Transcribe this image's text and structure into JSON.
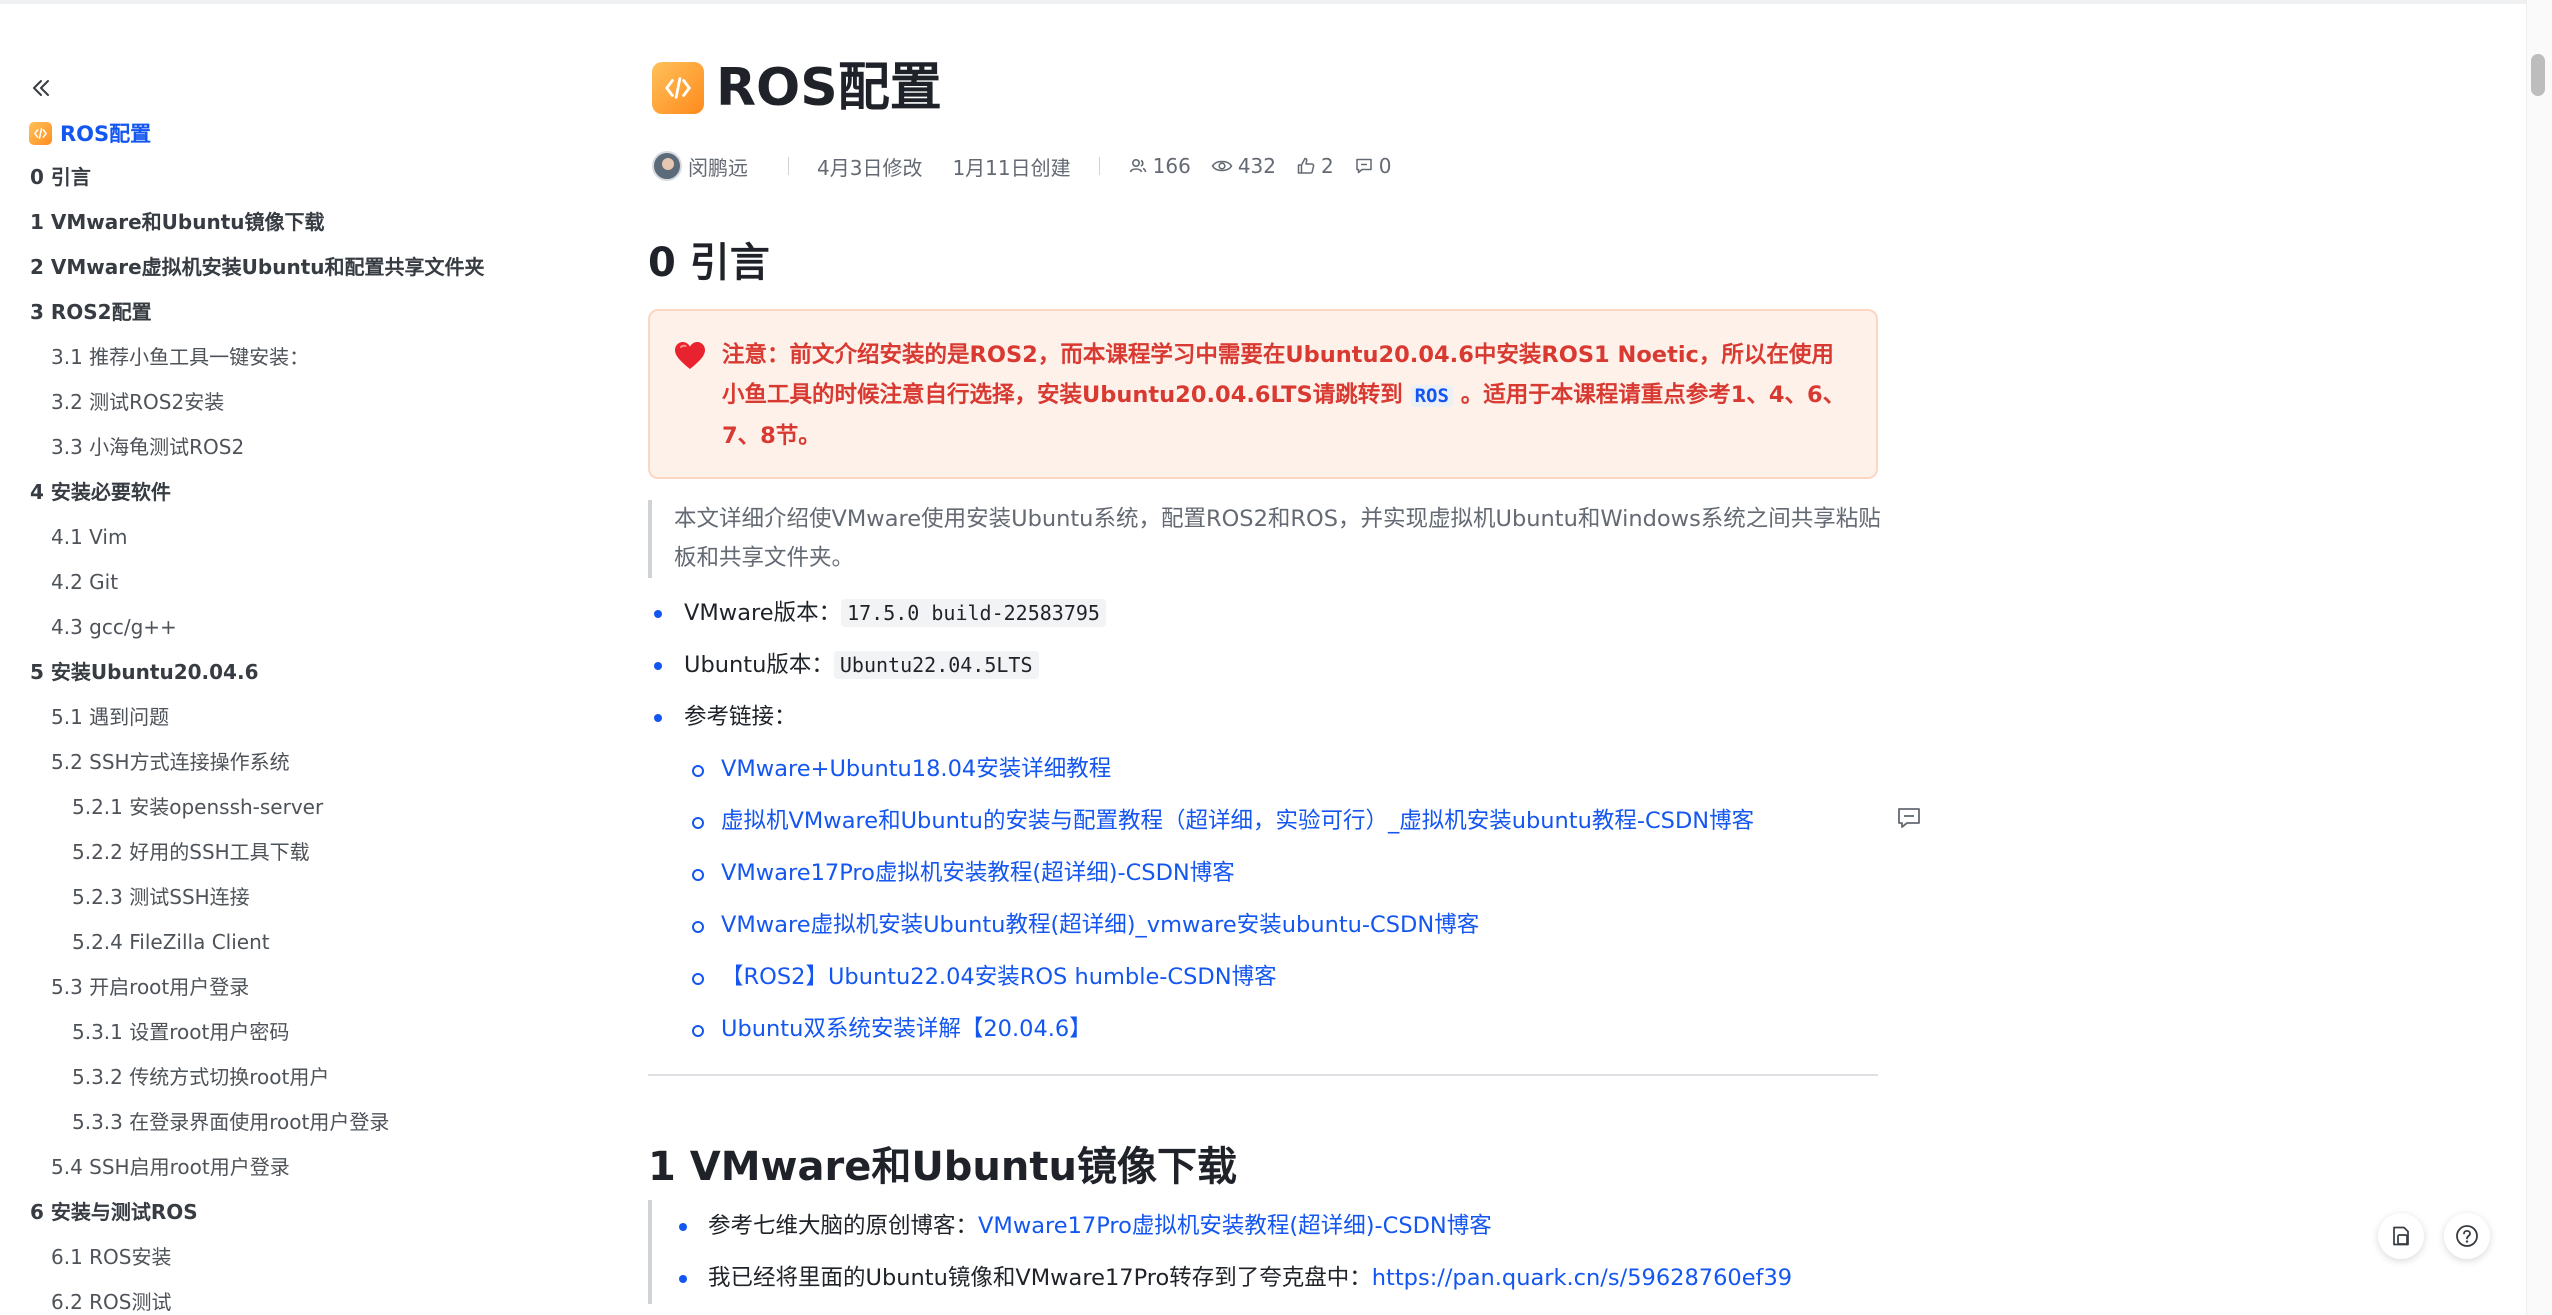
{
  "sidebar": {
    "current": "ROS配置",
    "toc": [
      {
        "label": "0 引言",
        "level": 1
      },
      {
        "label": "1 VMware和Ubuntu镜像下载",
        "level": 1
      },
      {
        "label": "2 VMware虚拟机安装Ubuntu和配置共享文件夹",
        "level": 1
      },
      {
        "label": "3 ROS2配置",
        "level": 1
      },
      {
        "label": "3.1 推荐小鱼工具一键安装：",
        "level": 2
      },
      {
        "label": "3.2 测试ROS2安装",
        "level": 2
      },
      {
        "label": "3.3 小海龟测试ROS2",
        "level": 2
      },
      {
        "label": "4 安装必要软件",
        "level": 1
      },
      {
        "label": "4.1 Vim",
        "level": 2
      },
      {
        "label": "4.2 Git",
        "level": 2
      },
      {
        "label": "4.3 gcc/g++",
        "level": 2
      },
      {
        "label": "5 安装Ubuntu20.04.6",
        "level": 1
      },
      {
        "label": "5.1 遇到问题",
        "level": 2
      },
      {
        "label": "5.2 SSH方式连接操作系统",
        "level": 2
      },
      {
        "label": "5.2.1 安装openssh-server",
        "level": 3
      },
      {
        "label": "5.2.2 好用的SSH工具下载",
        "level": 3
      },
      {
        "label": "5.2.3 测试SSH连接",
        "level": 3
      },
      {
        "label": "5.2.4 FileZilla Client",
        "level": 3
      },
      {
        "label": "5.3 开启root用户登录",
        "level": 2
      },
      {
        "label": "5.3.1 设置root用户密码",
        "level": 3
      },
      {
        "label": "5.3.2 传统方式切换root用户",
        "level": 3
      },
      {
        "label": "5.3.3 在登录界面使用root用户登录",
        "level": 3
      },
      {
        "label": "5.4 SSH启用root用户登录",
        "level": 2
      },
      {
        "label": "6 安装与测试ROS",
        "level": 1
      },
      {
        "label": "6.1 ROS安装",
        "level": 2
      },
      {
        "label": "6.2 ROS测试",
        "level": 2
      }
    ]
  },
  "doc": {
    "title": "ROS配置",
    "author": "闵鹏远",
    "modified": "4月3日修改",
    "created": "1月11日创建",
    "stats": {
      "collaborators": "166",
      "views": "432",
      "likes": "2",
      "comments": "0"
    }
  },
  "section0": {
    "heading": "0 引言",
    "callout": {
      "text_before": "注意：前文介绍安装的是ROS2，而本课程学习中需要在Ubuntu20.04.6中安装ROS1 Noetic，所以在使用小鱼工具的时候注意自行选择，安装Ubuntu20.04.6LTS请跳转到 ",
      "code": "ROS",
      "text_after": " 。适用于本课程请重点参考1、4、6、7、8节。"
    },
    "quote": "本文详细介绍使VMware使用安装Ubuntu系统，配置ROS2和ROS，并实现虚拟机Ubuntu和Windows系统之间共享粘贴板和共享文件夹。",
    "vmware_label": "VMware版本：",
    "vmware_code": "17.5.0 build-22583795",
    "ubuntu_label": "Ubuntu版本：",
    "ubuntu_code": "Ubuntu22.04.5LTS",
    "refs_label": "参考链接：",
    "links": [
      "VMware+Ubuntu18.04安装详细教程",
      "虚拟机VMware和Ubuntu的安装与配置教程（超详细，实验可行）_虚拟机安装ubuntu教程-CSDN博客",
      "VMware17Pro虚拟机安装教程(超详细)-CSDN博客",
      "VMware虚拟机安装Ubuntu教程(超详细)_vmware安装ubuntu-CSDN博客",
      "【ROS2】Ubuntu22.04安装ROS humble-CSDN博客",
      "Ubuntu双系统安装详解【20.04.6】"
    ]
  },
  "section1": {
    "heading": "1 VMware和Ubuntu镜像下载",
    "item1_prefix": "参考七维大脑的原创博客：",
    "item1_link": "VMware17Pro虚拟机安装教程(超详细)-CSDN博客",
    "item2_prefix": "我已经将里面的Ubuntu镜像和VMware17Pro转存到了夸克盘中：",
    "item2_link": "https://pan.quark.cn/s/59628760ef39"
  },
  "colors": {
    "accent": "#1456f0",
    "warning": "#d83931",
    "callout_bg": "#fef1ea",
    "icon_orange": "#ff8d1f"
  },
  "icons": [
    "collapse-left-icon",
    "code-doc-icon",
    "collaborators-icon",
    "views-icon",
    "like-icon",
    "comment-icon",
    "heart-icon",
    "add-comment-icon",
    "doc-info-icon",
    "help-icon"
  ]
}
